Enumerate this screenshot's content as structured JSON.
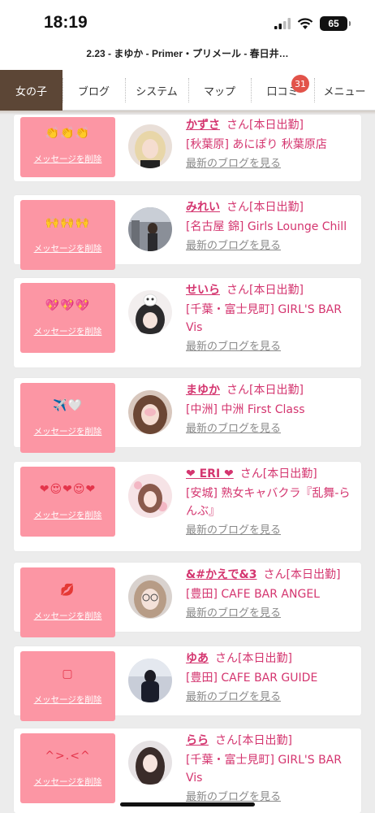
{
  "status": {
    "time": "18:19",
    "battery": "65"
  },
  "url": {
    "title": "2.23 - まゆか - Primer・プリメール - 春日井…"
  },
  "nav": {
    "items": [
      {
        "label": "女の子",
        "active": true
      },
      {
        "label": "ブログ"
      },
      {
        "label": "システム"
      },
      {
        "label": "マップ"
      },
      {
        "label": "口コミ",
        "badge": "31"
      },
      {
        "label": "メニュー"
      }
    ]
  },
  "common": {
    "delete_label": "メッセージを削除",
    "blog_label": "最新のブログを見る",
    "san": "さん"
  },
  "cards": [
    {
      "emoji": "👏👏👏",
      "name": "かずさ",
      "status": "[本日出勤]",
      "shop": "[秋葉原] あにぽり 秋葉原店",
      "avatar": "blonde"
    },
    {
      "emoji": "🙌🙌🙌",
      "name": "みれい",
      "status": "[本日出勤]",
      "shop": "[名古屋 錦] Girls Lounge Chill",
      "avatar": "street"
    },
    {
      "emoji": "💖💖💖",
      "name": "せいら",
      "status": "[本日出勤]",
      "shop": "[千葉・富士見町] GIRL'S BAR Vis",
      "avatar": "cat"
    },
    {
      "emoji": "✈️🤍",
      "name": "まゆか",
      "status": "[本日出勤]",
      "shop": "[中洲] 中洲 First Class",
      "avatar": "brown"
    },
    {
      "emoji": "❤😍❤😍❤",
      "name": "❤ ERI ❤",
      "status": "[本日出勤]",
      "shop": "[安城] 熟女キャバクラ『乱舞-らんぶ』",
      "avatar": "pink"
    },
    {
      "emoji": "💋",
      "name": "&#かえで&3",
      "status": "[本日出勤]",
      "shop": "[豊田] CAFE BAR ANGEL",
      "avatar": "glasses"
    },
    {
      "emoji": "▢",
      "name": "ゆあ",
      "status": "[本日出勤]",
      "shop": "[豊田] CAFE BAR GUIDE",
      "avatar": "dark"
    },
    {
      "emoji": "^>.<^",
      "name": "らら",
      "status": "[本日出勤]",
      "shop": "[千葉・富士見町] GIRL'S BAR Vis",
      "avatar": "long"
    }
  ]
}
